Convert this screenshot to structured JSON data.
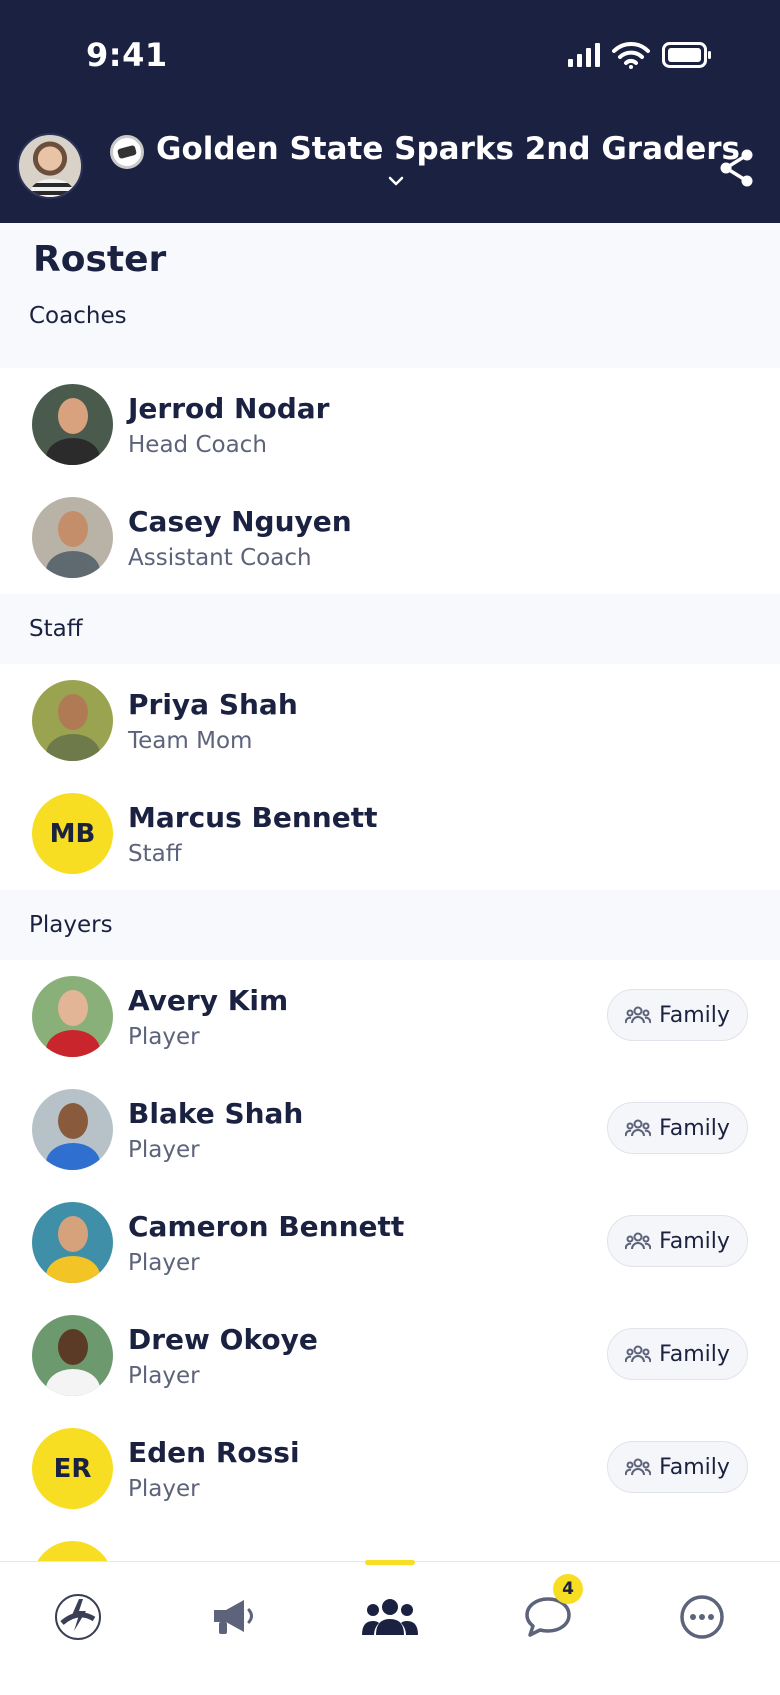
{
  "status_bar": {
    "time": "9:41"
  },
  "header": {
    "team_name": "Golden State Sparks 2nd Graders"
  },
  "page": {
    "title": "Roster",
    "sections": [
      {
        "label": "Coaches",
        "members": [
          {
            "name": "Jerrod Nodar",
            "role": "Head Coach",
            "avatar": "photo",
            "initials": ""
          },
          {
            "name": "Casey Nguyen",
            "role": "Assistant Coach",
            "avatar": "photo",
            "initials": ""
          }
        ]
      },
      {
        "label": "Staff",
        "members": [
          {
            "name": "Priya Shah",
            "role": "Team Mom",
            "avatar": "photo",
            "initials": ""
          },
          {
            "name": "Marcus Bennett",
            "role": "Staff",
            "avatar": "initials",
            "initials": "MB"
          }
        ]
      },
      {
        "label": "Players",
        "family_label": "Family",
        "members": [
          {
            "name": "Avery Kim",
            "role": "Player",
            "avatar": "photo",
            "initials": ""
          },
          {
            "name": "Blake Shah",
            "role": "Player",
            "avatar": "photo",
            "initials": ""
          },
          {
            "name": "Cameron Bennett",
            "role": "Player",
            "avatar": "photo",
            "initials": ""
          },
          {
            "name": "Drew Okoye",
            "role": "Player",
            "avatar": "photo",
            "initials": ""
          },
          {
            "name": "Eden Rossi",
            "role": "Player",
            "avatar": "initials",
            "initials": "ER"
          }
        ]
      }
    ]
  },
  "tabbar": {
    "tabs": [
      {
        "name": "team-logo-tab",
        "icon": "lightning-logo-icon"
      },
      {
        "name": "announcements-tab",
        "icon": "megaphone-icon"
      },
      {
        "name": "roster-tab",
        "icon": "people-icon",
        "active": true
      },
      {
        "name": "messages-tab",
        "icon": "chat-bubble-icon"
      },
      {
        "name": "more-tab",
        "icon": "more-icon"
      }
    ],
    "messages_badge": "4"
  },
  "colors": {
    "header_bg": "#1b2140",
    "accent_yellow": "#f7de22",
    "section_bg": "#f8f9fc",
    "muted_text": "#5d637a"
  }
}
